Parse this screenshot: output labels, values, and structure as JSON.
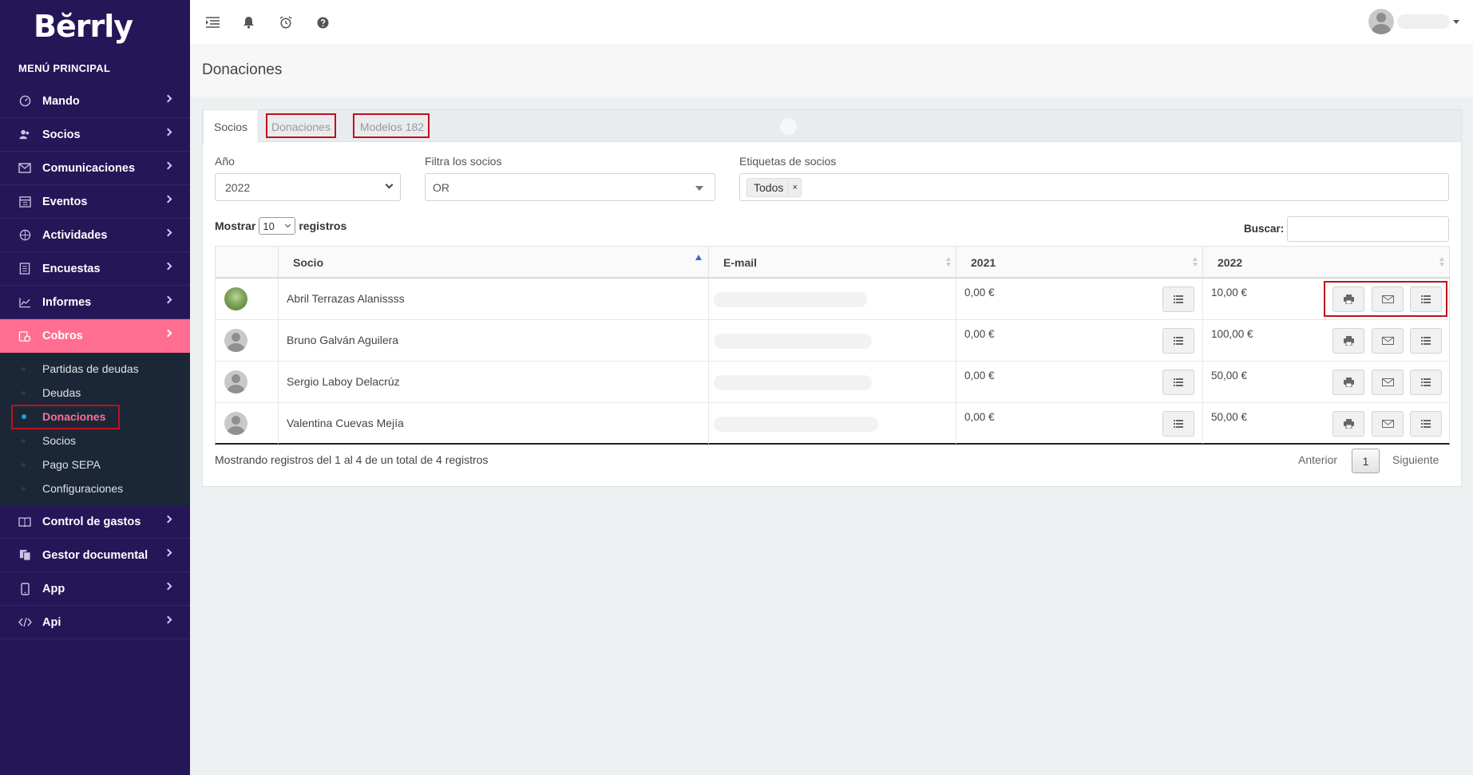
{
  "brand": {
    "logo_text": "Bĕrrly"
  },
  "sidebar": {
    "menu_title": "MENÚ PRINCIPAL",
    "items": [
      {
        "label": "Mando",
        "icon": "dashboard-icon"
      },
      {
        "label": "Socios",
        "icon": "users-icon"
      },
      {
        "label": "Comunicaciones",
        "icon": "envelope-icon"
      },
      {
        "label": "Eventos",
        "icon": "calendar-icon"
      },
      {
        "label": "Actividades",
        "icon": "basketball-icon"
      },
      {
        "label": "Encuestas",
        "icon": "list-icon"
      },
      {
        "label": "Informes",
        "icon": "chart-icon"
      },
      {
        "label": "Cobros",
        "icon": "coins-icon"
      },
      {
        "label": "Control de gastos",
        "icon": "book-icon"
      },
      {
        "label": "Gestor documental",
        "icon": "documents-icon"
      },
      {
        "label": "App",
        "icon": "mobile-icon"
      },
      {
        "label": "Api",
        "icon": "code-icon"
      }
    ],
    "submenu": [
      {
        "label": "Partidas de deudas"
      },
      {
        "label": "Deudas"
      },
      {
        "label": "Donaciones"
      },
      {
        "label": "Socios"
      },
      {
        "label": "Pago SEPA"
      },
      {
        "label": "Configuraciones"
      }
    ]
  },
  "page": {
    "title": "Donaciones"
  },
  "tabs": [
    {
      "label": "Socios"
    },
    {
      "label": "Donaciones"
    },
    {
      "label": "Modelos 182"
    }
  ],
  "filters": {
    "year_label": "Año",
    "year_value": "2022",
    "filter_label": "Filtra los socios",
    "filter_value": "OR",
    "tags_label": "Etiquetas de socios",
    "tag_chip": "Todos",
    "tag_remove": "×"
  },
  "table_controls": {
    "show_prefix": "Mostrar",
    "page_length": "10",
    "show_suffix": "registros",
    "search_label": "Buscar:"
  },
  "table": {
    "columns": [
      "Socio",
      "E-mail",
      "2021",
      "2022"
    ],
    "rows": [
      {
        "name": "Abril Terrazas Alanissss",
        "y2021": "0,00 €",
        "y2022": "10,00 €"
      },
      {
        "name": "Bruno Galván Aguilera",
        "y2021": "0,00 €",
        "y2022": "100,00 €"
      },
      {
        "name": "Sergio Laboy Delacrúz",
        "y2021": "0,00 €",
        "y2022": "50,00 €"
      },
      {
        "name": "Valentina Cuevas Mejía",
        "y2021": "0,00 €",
        "y2022": "50,00 €"
      }
    ]
  },
  "footer": {
    "info": "Mostrando registros del 1 al 4 de un total de 4 registros",
    "prev": "Anterior",
    "current_page": "1",
    "next": "Siguiente"
  },
  "colors": {
    "sidebar_bg": "#251658",
    "accent": "#ff6e91",
    "highlight": "#c0101a"
  }
}
